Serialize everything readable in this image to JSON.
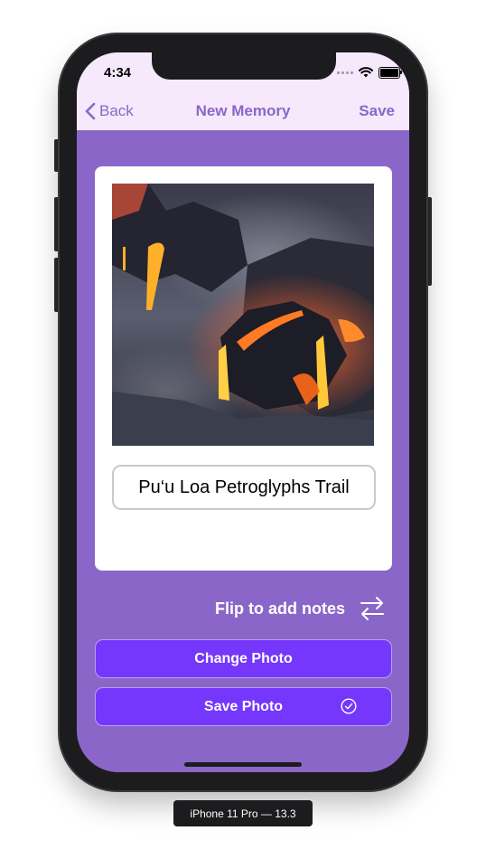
{
  "status_bar": {
    "time": "4:34"
  },
  "nav": {
    "back_label": "Back",
    "title": "New Memory",
    "save_label": "Save"
  },
  "memory_card": {
    "photo_icon": "lava-photo",
    "title_value": "Pu‘u Loa Petroglyphs Trail"
  },
  "flip": {
    "label": "Flip to add notes",
    "icon": "flip-arrows-icon"
  },
  "buttons": {
    "change_photo": "Change Photo",
    "save_photo": "Save Photo",
    "save_photo_icon": "checkmark-circle-icon"
  },
  "simulator": {
    "device_label": "iPhone 11 Pro — 13.3"
  },
  "colors": {
    "accent": "#8b66c9",
    "nav_bg": "#f5e9fb",
    "button": "#7437fb"
  }
}
